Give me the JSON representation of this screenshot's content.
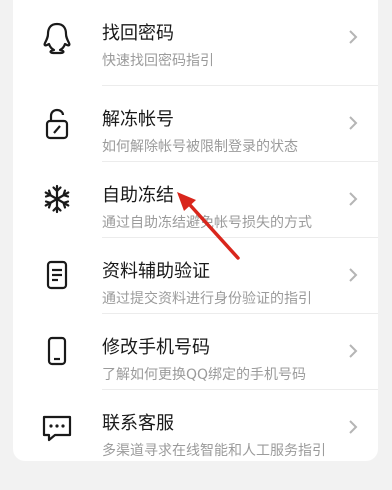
{
  "menu": {
    "items": [
      {
        "title": "找回密码",
        "subtitle": "快速找回密码指引",
        "icon": "penguin-outline-icon"
      },
      {
        "title": "解冻帐号",
        "subtitle": "如何解除帐号被限制登录的状态",
        "icon": "unlock-icon"
      },
      {
        "title": "自助冻结",
        "subtitle": "通过自助冻结避免帐号损失的方式",
        "icon": "snowflake-icon"
      },
      {
        "title": "资料辅助验证",
        "subtitle": "通过提交资料进行身份验证的指引",
        "icon": "document-icon"
      },
      {
        "title": "修改手机号码",
        "subtitle": "了解如何更换QQ绑定的手机号码",
        "icon": "phone-icon"
      },
      {
        "title": "联系客服",
        "subtitle": "多渠道寻求在线智能和人工服务指引",
        "icon": "chat-bubble-icon"
      }
    ]
  },
  "annotation": {
    "color": "#d9261c",
    "points_to": "自助冻结"
  }
}
